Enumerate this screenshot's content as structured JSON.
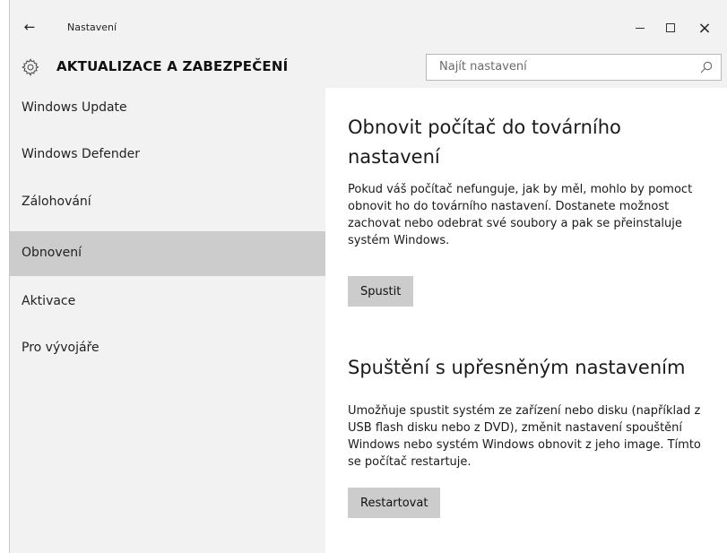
{
  "window": {
    "title": "Nastavení",
    "back_icon": "←",
    "minimize_label": "minimize",
    "maximize_label": "maximize",
    "close_label": "×"
  },
  "header": {
    "section_title": "AKTUALIZACE A ZABEZPEČENÍ",
    "search_placeholder": "Najít nastavení"
  },
  "sidebar": {
    "items": [
      {
        "label": "Windows Update",
        "selected": false
      },
      {
        "label": "Windows Defender",
        "selected": false
      },
      {
        "label": "Zálohování",
        "selected": false
      },
      {
        "label": "Obnovení",
        "selected": true
      },
      {
        "label": "Aktivace",
        "selected": false
      },
      {
        "label": "Pro vývojáře",
        "selected": false
      }
    ]
  },
  "main": {
    "reset": {
      "title_line1": "Obnovit počítač do továrního",
      "title_line2": "nastavení",
      "description": "Pokud váš počítač nefunguje, jak by měl, mohlo by pomoct obnovit ho do továrního nastavení. Dostanete možnost zachovat nebo odebrat své soubory a pak se přeinstaluje systém Windows.",
      "button_label": "Spustit"
    },
    "advanced": {
      "title": "Spuštění s upřesněným nastavením",
      "description": "Umožňuje spustit systém ze zařízení nebo disku (například z USB flash disku nebo z DVD), změnit nastavení spouštění Windows nebo systém Windows obnovit z jeho image. Tímto se počítač restartuje.",
      "button_label": "Restartovat"
    }
  },
  "colors": {
    "chrome_bg": "#f2f2f2",
    "selected_bg": "#cccccc",
    "content_bg": "#ffffff",
    "button_bg": "#cccccc"
  }
}
